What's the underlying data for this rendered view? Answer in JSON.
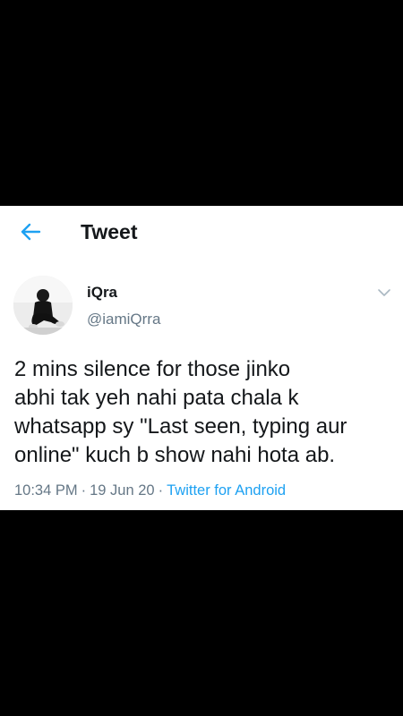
{
  "header": {
    "title": "Tweet",
    "back_icon": "arrow-left-icon",
    "accent_color": "#1da1f2"
  },
  "tweet": {
    "author_name": "iQra",
    "author_handle": "@iamiQrra",
    "more_icon": "chevron-down-icon",
    "text": "2 mins silence for those jinko\nabhi tak yeh nahi pata chala k\nwhatsapp sy \"Last seen, typing aur\nonline\" kuch b show nahi hota ab.",
    "time": "10:34 PM",
    "date": "19 Jun 20",
    "separator": "·",
    "source": "Twitter for Android"
  }
}
